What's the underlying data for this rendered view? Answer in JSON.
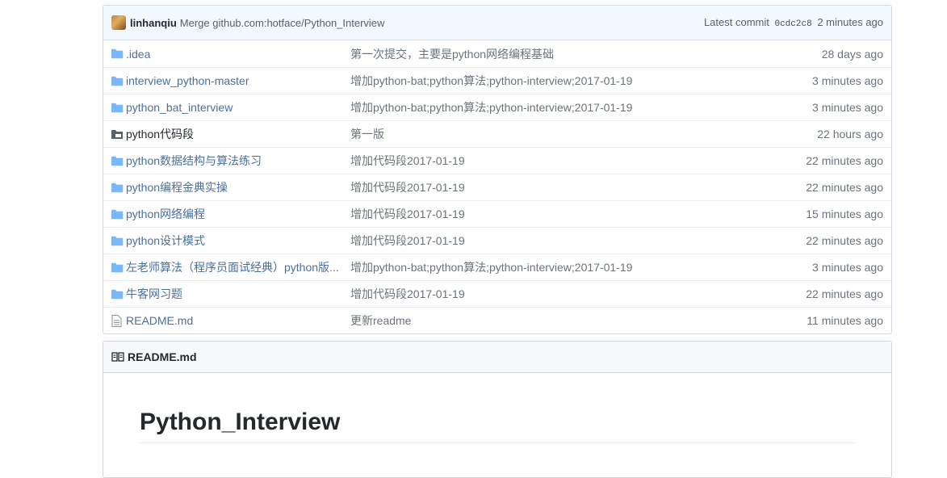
{
  "latest_commit": {
    "author": "linhanqiu",
    "message": "Merge github.com:hotface/Python_Interview",
    "prefix": "Latest commit",
    "sha": "0cdc2c8",
    "age": "2 minutes ago"
  },
  "files": [
    {
      "name": ".idea",
      "icon": "folder-icon",
      "message": "第一次提交，主要是python网络编程基础",
      "age": "28 days ago"
    },
    {
      "name": "interview_python-master",
      "icon": "folder-icon",
      "message": "增加python-bat;python算法;python-interview;2017-01-19",
      "age": "3 minutes ago"
    },
    {
      "name": "python_bat_interview",
      "icon": "folder-icon",
      "message": "增加python-bat;python算法;python-interview;2017-01-19",
      "age": "3 minutes ago"
    },
    {
      "name": "python代码段",
      "icon": "submodule-icon",
      "message": "第一版",
      "age": "22 hours ago"
    },
    {
      "name": "python数据结构与算法练习",
      "icon": "folder-icon",
      "message": "增加代码段2017-01-19",
      "age": "22 minutes ago"
    },
    {
      "name": "python编程金典实操",
      "icon": "folder-icon",
      "message": "增加代码段2017-01-19",
      "age": "22 minutes ago"
    },
    {
      "name": "python网络编程",
      "icon": "folder-icon",
      "message": "增加代码段2017-01-19",
      "age": "15 minutes ago"
    },
    {
      "name": "python设计模式",
      "icon": "folder-icon",
      "message": "增加代码段2017-01-19",
      "age": "22 minutes ago"
    },
    {
      "name": "左老师算法（程序员面试经典）python版...",
      "icon": "folder-icon",
      "message": "增加python-bat;python算法;python-interview;2017-01-19",
      "age": "3 minutes ago"
    },
    {
      "name": "牛客网习题",
      "icon": "folder-icon",
      "message": "增加代码段2017-01-19",
      "age": "22 minutes ago"
    },
    {
      "name": "README.md",
      "icon": "file-icon",
      "message": "更新readme",
      "age": "11 minutes ago"
    }
  ],
  "readme": {
    "header": "README.md",
    "title": "Python_Interview"
  },
  "colors": {
    "link": "#4a6f9c",
    "folder": "#79b8ff",
    "commit_bg": "#f1f8ff"
  }
}
